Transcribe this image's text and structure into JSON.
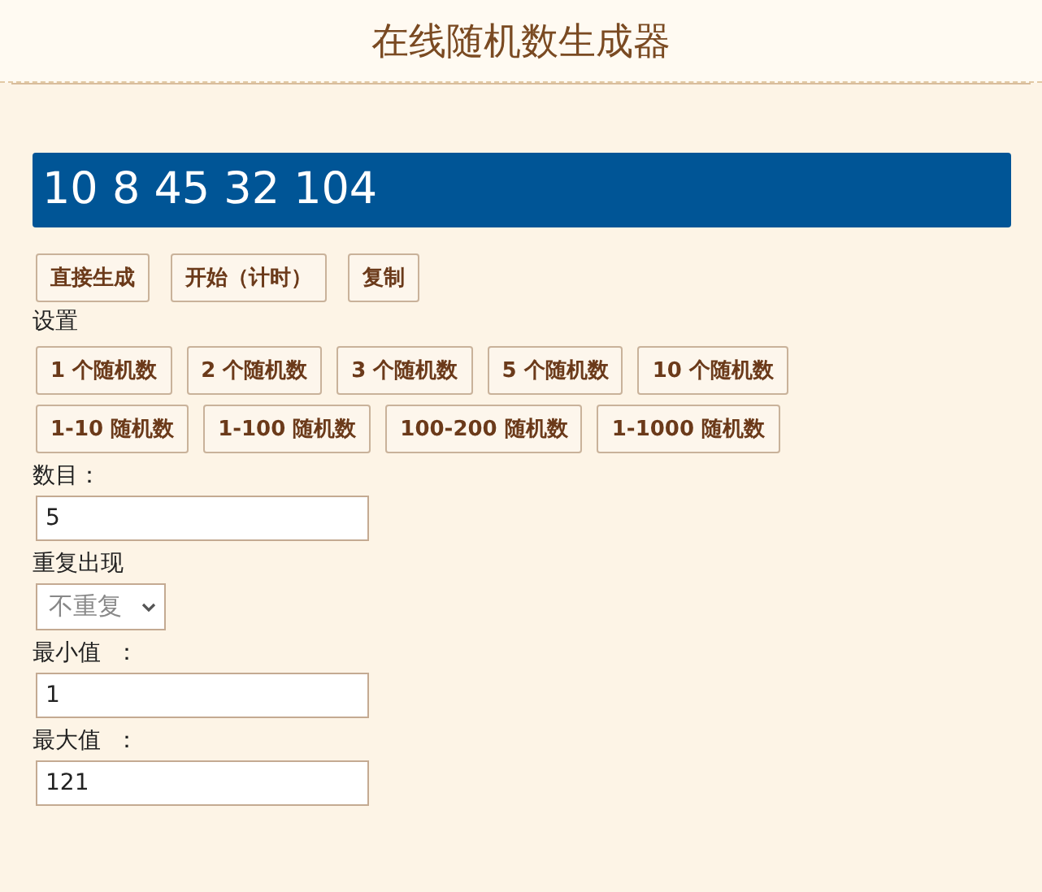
{
  "title": "在线随机数生成器",
  "result": "10 8 45 32 104",
  "action_buttons": [
    "直接生成",
    "开始（计时）",
    "复制"
  ],
  "settings_label": "设置",
  "count_buttons": [
    "1 个随机数",
    "2 个随机数",
    "3 个随机数",
    "5 个随机数",
    "10 个随机数"
  ],
  "range_buttons": [
    "1-10 随机数",
    "1-100 随机数",
    "100-200 随机数",
    "1-1000 随机数"
  ],
  "fields": [
    {
      "kind": "input",
      "label": "数目：",
      "value": "5"
    },
    {
      "kind": "select",
      "label": "重复出现",
      "value": "不重复"
    },
    {
      "kind": "input",
      "label": "最小值  ：",
      "value": "1"
    },
    {
      "kind": "input",
      "label": "最大值  ：",
      "value": "121"
    }
  ]
}
